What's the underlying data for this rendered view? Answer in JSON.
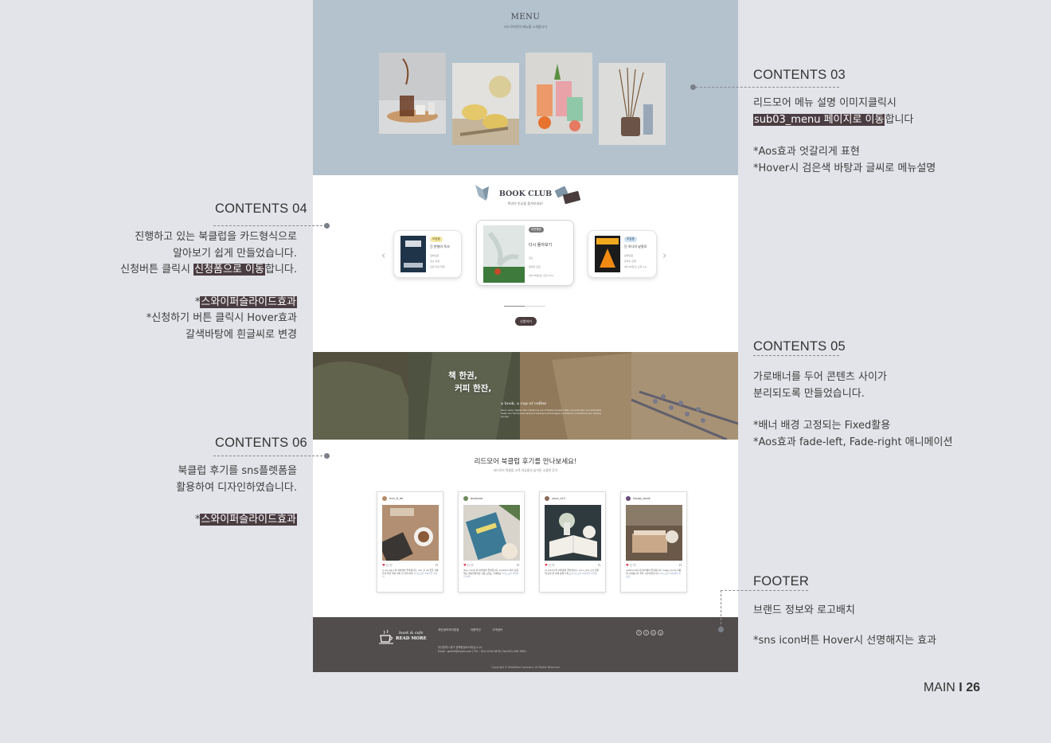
{
  "mockup": {
    "menu": {
      "title": "MENU",
      "subtitle": "리드모어만의 메뉴를 소개합니다"
    },
    "bookclub": {
      "title": "BOOK CLUB",
      "subtitle": "책과의 만남을 즐겨보세요!",
      "cards": [
        {
          "tag": "모집중",
          "title": "긴 판형의 독서",
          "meta": [
            "참여인원",
            "장소 미정",
            "모집 마감 임박"
          ]
        },
        {
          "tag": "대면활동",
          "title": "다시 돌아보기",
          "meta": [
            "장소",
            "참여자 모집",
            "9월 28일(토) 오전 10시"
          ]
        },
        {
          "tag": "모집중",
          "title": "단 하나의 낱말로",
          "meta": [
            "참여인원",
            "온라인 진행",
            "9월 28일 토 오후 2시"
          ]
        }
      ],
      "apply_label": "신청하기"
    },
    "banner": {
      "headline_1": "책 한권,",
      "headline_2": "커피 한잔,",
      "english": "a book, a cup of coffee",
      "desc": "Savor every chapter with a steaming cup of freshly brewed coffee, aromatic teas, and delectable treats. Our harmonious pairing of reading and beverages is curated to complement your reading journey."
    },
    "reviews": {
      "title": "리드모어 북클럽 후기를 만나보세요!",
      "subtitle": "리드모어 북클럽 고객 리뷰들의 남겨준 소중한 후기",
      "posts": [
        {
          "user": "min_lt_da",
          "caption": "d_da_lvg니 외 여러명이 좋아합니다. min_lt_da 좋은 사람들과 좋은 책과 커피 한 잔의 여유",
          "tags": "#리드모어 #북클럽 #독서"
        },
        {
          "user": "bookzoa",
          "caption": "lliyo_min님 외 여러명이 좋아합니다. bookzoa 이번 모임 책도 재미있었어요 다음 모임도 기대돼요",
          "tags": "#리드모어 #북클럽 #책"
        },
        {
          "user": "yoon_s12",
          "caption": "di_moo님 외 여러명이 좋아합니다. yoon_s12 오늘 읽은 책 모임 꽃 카페 분위기 최고",
          "tags": "#리드모어 #북클럽 #카페"
        },
        {
          "user": "happy_book",
          "caption": "readmore님 외 여러명이 좋아합니다. happy_book 다음 책 기대됩니다 좋은 시간이었습니다",
          "tags": "#리드모어 #북클럽 #모임"
        }
      ]
    },
    "footer": {
      "logo_line1": "book & cafe",
      "logo_line2": "READ MORE",
      "links": [
        "개인정보처리방침",
        "이용약관",
        "고객센터"
      ],
      "address": "부산광역시 중구 광복중앙로24번길 4-10",
      "contact": "Email : gmfcfi@naver.com  |  TEL : 010-1234-5678  |  Fax:031-456-7890",
      "copyright": "Copyright © ReadMore Company. All Rights Reserved",
      "sns": [
        "f",
        "t",
        "o",
        "y"
      ]
    }
  },
  "annotations": {
    "c03": {
      "heading": "CONTENTS 03",
      "l1": "리드모어 메뉴 설명 이미지클릭시",
      "l2_hl": "sub03_menu  페이지로 이동",
      "l2_rest": "합니다",
      "l3": "*Aos효과 엇갈리게 표현",
      "l4": "*Hover시 검은색 바탕과 글씨로 메뉴설명"
    },
    "c04": {
      "heading": "CONTENTS 04",
      "l1": "진행하고 있는 북클럽을 카드형식으로",
      "l2": "알아보기 쉽게 만들었습니다.",
      "l3_pre": "신청버튼 클릭시 ",
      "l3_hl": "신청폼으로 이동",
      "l3_post": "합니다.",
      "l4_pre": "*",
      "l4_hl": "스와이퍼슬라이드효과",
      "l5": "*신청하기 버튼 클릭시 Hover효과",
      "l6": "갈색바탕에 흰글씨로 변경"
    },
    "c05": {
      "heading": "CONTENTS 05",
      "l1": "가로배너를 두어 콘텐츠 사이가",
      "l2": "분리되도록 만들었습니다.",
      "l3": "*배너 배경 고정되는 Fixed활용",
      "l4": "*Aos효과 fade-left, Fade-right 애니메이션"
    },
    "c06": {
      "heading": "CONTENTS 06",
      "l1": "북클럽 후기를 sns플렛폼을",
      "l2": "활용하여 디자인하였습니다.",
      "l3_pre": "*",
      "l3_hl": "스와이퍼슬라이드효과"
    },
    "footer": {
      "heading": "FOOTER",
      "l1": "브랜드 정보와 로고배치",
      "l2": "*sns icon버튼 Hover시 선명해지는 효과"
    }
  },
  "page": {
    "section": "MAIN",
    "separator": "I",
    "number": "26"
  },
  "colors": {
    "background": "#e3e4e9",
    "menu_bg": "#b3c2cd",
    "highlight": "#4a3d41",
    "footer_bg": "#504d4c"
  }
}
